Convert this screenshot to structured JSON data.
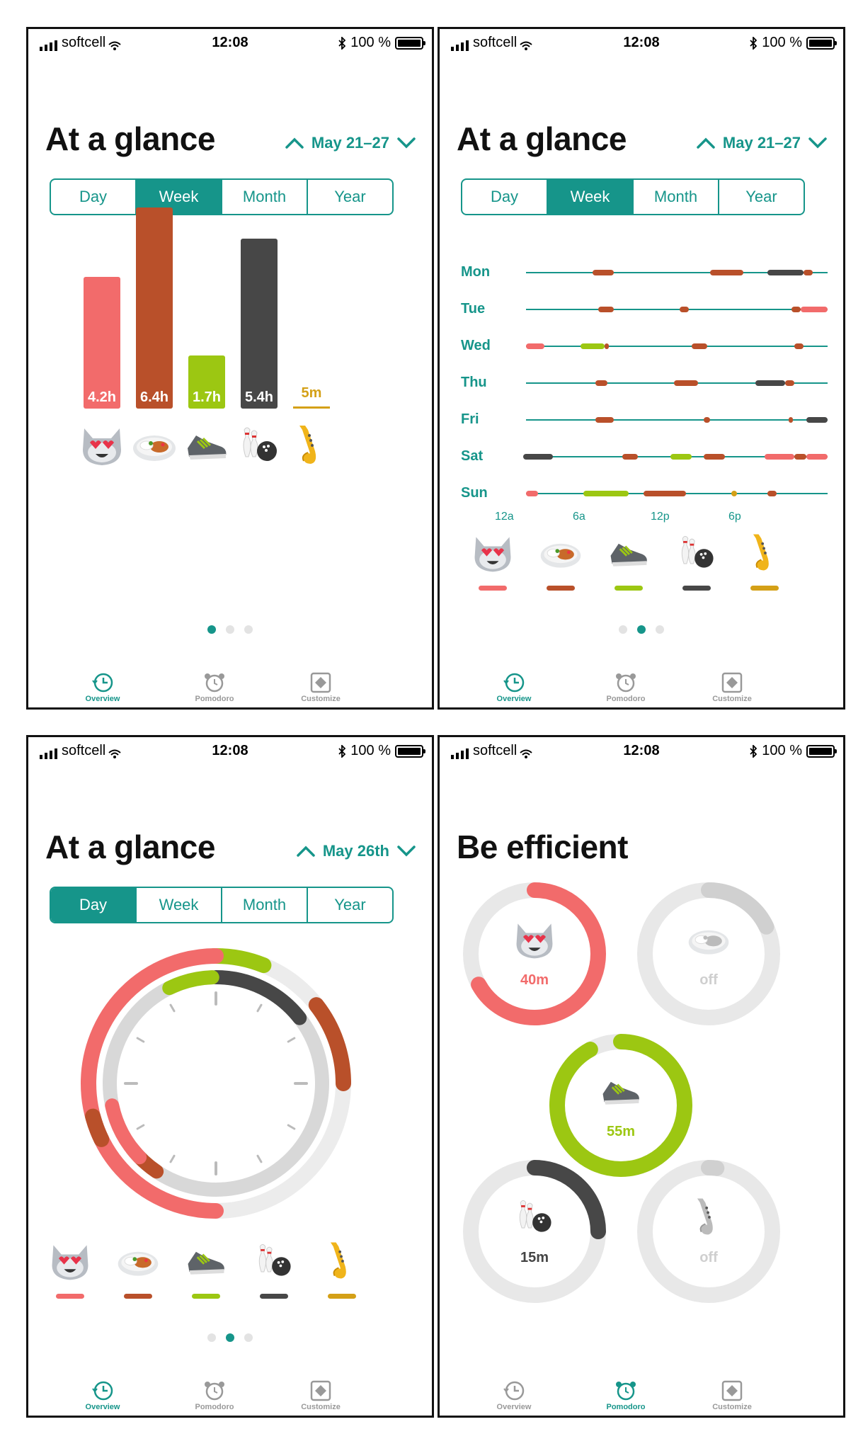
{
  "status": {
    "carrier": "softcell",
    "time": "12:08",
    "battery": "100 %"
  },
  "colors": {
    "accent": "#16958a",
    "cat": "#f26b6b",
    "food": "#b9502a",
    "shoe": "#9cc712",
    "bowling": "#474747",
    "sax": "#d4a017",
    "track": "#e6e6e6"
  },
  "tabs": [
    "Overview",
    "Pomodoro",
    "Customize"
  ],
  "screens": {
    "s1": {
      "title": "At a glance",
      "range": "May 21–27",
      "segments": [
        "Day",
        "Week",
        "Month",
        "Year"
      ],
      "active": "Week",
      "bars": [
        {
          "label": "4.2h",
          "value": 4.2
        },
        {
          "label": "6.4h",
          "value": 6.4
        },
        {
          "label": "1.7h",
          "value": 1.7
        },
        {
          "label": "5.4h",
          "value": 5.4
        },
        {
          "label": "5m",
          "value": 0.083
        }
      ]
    },
    "s2": {
      "title": "At a glance",
      "range": "May 21–27",
      "segments": [
        "Day",
        "Week",
        "Month",
        "Year"
      ],
      "active": "Week",
      "days": [
        "Mon",
        "Tue",
        "Wed",
        "Thu",
        "Fri",
        "Sat",
        "Sun"
      ],
      "ticks": [
        "12a",
        "6a",
        "12p",
        "6p"
      ]
    },
    "s3": {
      "title": "At a glance",
      "range": "May 26th",
      "segments": [
        "Day",
        "Week",
        "Month",
        "Year"
      ],
      "active": "Day"
    },
    "s4": {
      "title": "Be efficient",
      "rings": [
        {
          "label": "40m",
          "fraction": 0.67
        },
        {
          "label": "off",
          "fraction": 0.18
        },
        {
          "label": "55m",
          "fraction": 0.92
        },
        {
          "label": "15m",
          "fraction": 0.25
        },
        {
          "label": "off",
          "fraction": 0.02
        }
      ]
    }
  }
}
